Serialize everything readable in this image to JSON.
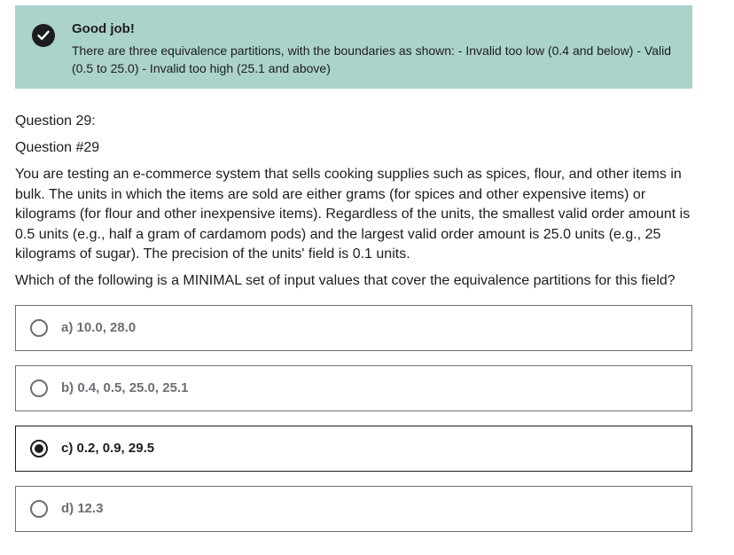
{
  "feedback": {
    "icon": "check-circle-icon",
    "title": "Good job!",
    "text": "There are three equivalence partitions, with the boundaries as shown: - Invalid too low (0.4 and below) - Valid (0.5 to 25.0) - Invalid too high (25.1 and above)"
  },
  "question": {
    "number_label": "Question 29:",
    "id_label": "Question #29",
    "body": "You are testing an e-commerce system that sells cooking supplies such as spices, flour, and other items in bulk. The units in which the items are sold are either grams (for spices and other expensive items) or kilograms (for flour and other inexpensive items). Regardless of the units, the smallest valid order amount is 0.5 units (e.g., half a gram of cardamom pods) and the largest valid order amount is 25.0 units (e.g., 25 kilograms of sugar). The precision of the units' field is 0.1 units.",
    "prompt": "Which of the following is a MINIMAL set of input values that cover the equivalence partitions for this field?"
  },
  "options": [
    {
      "label": "a) 10.0, 28.0",
      "selected": false
    },
    {
      "label": "b) 0.4, 0.5, 25.0, 25.1",
      "selected": false
    },
    {
      "label": "c) 0.2, 0.9, 29.5",
      "selected": true
    },
    {
      "label": "d) 12.3",
      "selected": false
    }
  ],
  "colors": {
    "feedback_bg": "#acd2cc",
    "text": "#1c1d1f",
    "muted": "#6a6f73"
  }
}
